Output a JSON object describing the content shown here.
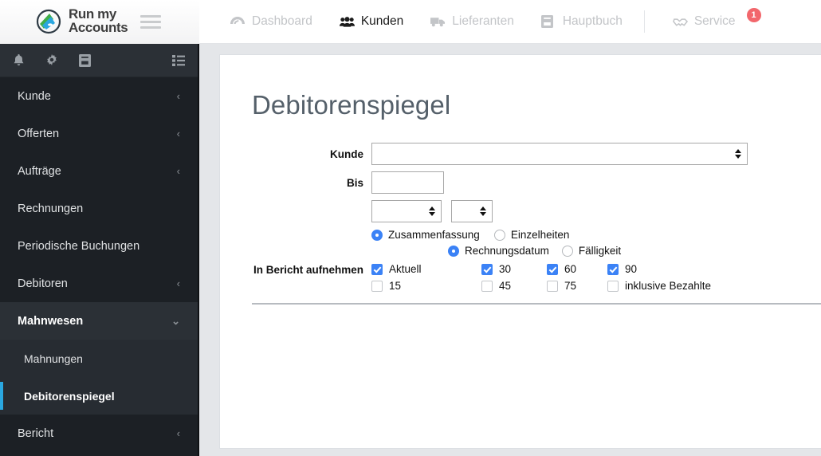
{
  "brand": {
    "line1": "Run my",
    "line2": "Accounts",
    "logo_icon": "runmyaccounts-logo-icon"
  },
  "topnav": {
    "menu_icon": "hamburger-menu-icon",
    "items": [
      {
        "label": "Dashboard",
        "icon": "dashboard-icon",
        "active": false
      },
      {
        "label": "Kunden",
        "icon": "customers-icon",
        "active": true
      },
      {
        "label": "Lieferanten",
        "icon": "truck-icon",
        "active": false
      },
      {
        "label": "Hauptbuch",
        "icon": "ledger-book-icon",
        "active": false
      }
    ],
    "service": {
      "label": "Service",
      "icon": "service-handshake-icon",
      "badge": "1"
    }
  },
  "sidebar": {
    "icons": [
      {
        "name": "bell-icon"
      },
      {
        "name": "gear-icon"
      },
      {
        "name": "book-icon"
      },
      {
        "name": "list-icon"
      }
    ],
    "items": [
      {
        "label": "Kunde",
        "chevron": "‹",
        "state": "collapsed"
      },
      {
        "label": "Offerten",
        "chevron": "‹",
        "state": "collapsed"
      },
      {
        "label": "Aufträge",
        "chevron": "‹",
        "state": "collapsed"
      },
      {
        "label": "Rechnungen",
        "chevron": "",
        "state": "plain"
      },
      {
        "label": "Periodische Buchungen",
        "chevron": "",
        "state": "plain"
      },
      {
        "label": "Debitoren",
        "chevron": "‹",
        "state": "collapsed"
      },
      {
        "label": "Mahnwesen",
        "chevron": "⌄",
        "state": "open"
      }
    ],
    "subitems": [
      {
        "label": "Mahnungen",
        "current": false
      },
      {
        "label": "Debitorenspiegel",
        "current": true
      }
    ],
    "after": [
      {
        "label": "Bericht",
        "chevron": "‹",
        "state": "collapsed"
      }
    ]
  },
  "page": {
    "title": "Debitorenspiegel",
    "fields": {
      "kunde_label": "Kunde",
      "kunde_value": "",
      "bis_label": "Bis",
      "bis_value": "",
      "select_a_value": "",
      "select_b_value": ""
    },
    "detail_radios": [
      {
        "label": "Zusammenfassung",
        "checked": true
      },
      {
        "label": "Einzelheiten",
        "checked": false
      }
    ],
    "date_radios": [
      {
        "label": "Rechnungsdatum",
        "checked": true
      },
      {
        "label": "Fälligkeit",
        "checked": false
      }
    ],
    "include_label": "In Bericht aufnehmen",
    "checkbox_columns": [
      [
        {
          "label": "Aktuell",
          "checked": true
        },
        {
          "label": "15",
          "checked": false
        }
      ],
      [
        {
          "label": "30",
          "checked": true
        },
        {
          "label": "45",
          "checked": false
        }
      ],
      [
        {
          "label": "60",
          "checked": true
        },
        {
          "label": "75",
          "checked": false
        }
      ],
      [
        {
          "label": "90",
          "checked": true
        },
        {
          "label": "inklusive Bezahlte",
          "checked": false
        }
      ]
    ]
  },
  "colors": {
    "accent_blue": "#3b82f6",
    "sidebar_accent": "#2aa7e0",
    "badge_red": "#f2676c",
    "title_gray": "#55606a",
    "sidebar_bg": "#1c2025"
  }
}
